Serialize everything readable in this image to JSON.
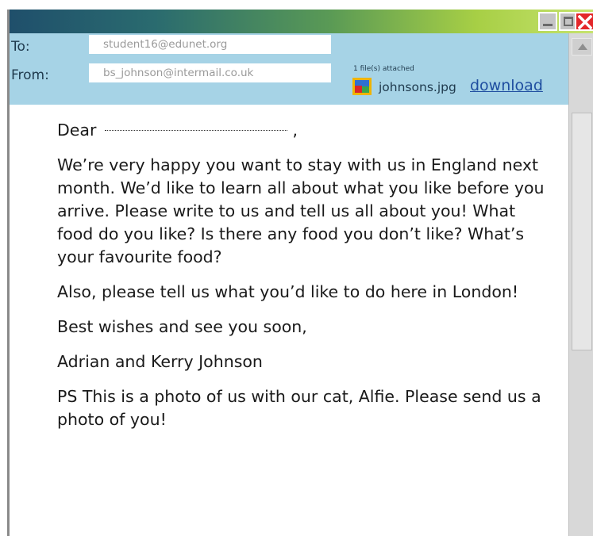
{
  "header": {
    "to_label": "To:",
    "to_value": "student16@edunet.org",
    "from_label": "From:",
    "from_value": "bs_johnson@intermail.co.uk",
    "attachment_count": "1 file(s) attached",
    "attachment_icon": "image-file-icon",
    "attachment_name": "johnsons.jpg",
    "download_label": "download"
  },
  "window_controls": [
    "minimize-icon",
    "maximize-icon",
    "close-icon"
  ],
  "message": {
    "greeting": "Dear",
    "greeting_end": ",",
    "paragraphs": [
      "We’re very happy you want to stay with us in England next month. We’d like to learn all about what you like before you arrive. Please write to us and tell us all about you! What food do you like? Is there any food you don’t like? What’s your favourite food?",
      "Also, please tell us what you’d like to do here in London!",
      "Best wishes and see you soon,",
      "Adrian and Kerry Johnson",
      "PS This is a photo of us with our cat, Alfie. Please send us a photo of you!"
    ]
  },
  "colors": {
    "header_bg": "#a6d3e6",
    "link": "#1f4ea0",
    "close_button": "#e3272a"
  }
}
